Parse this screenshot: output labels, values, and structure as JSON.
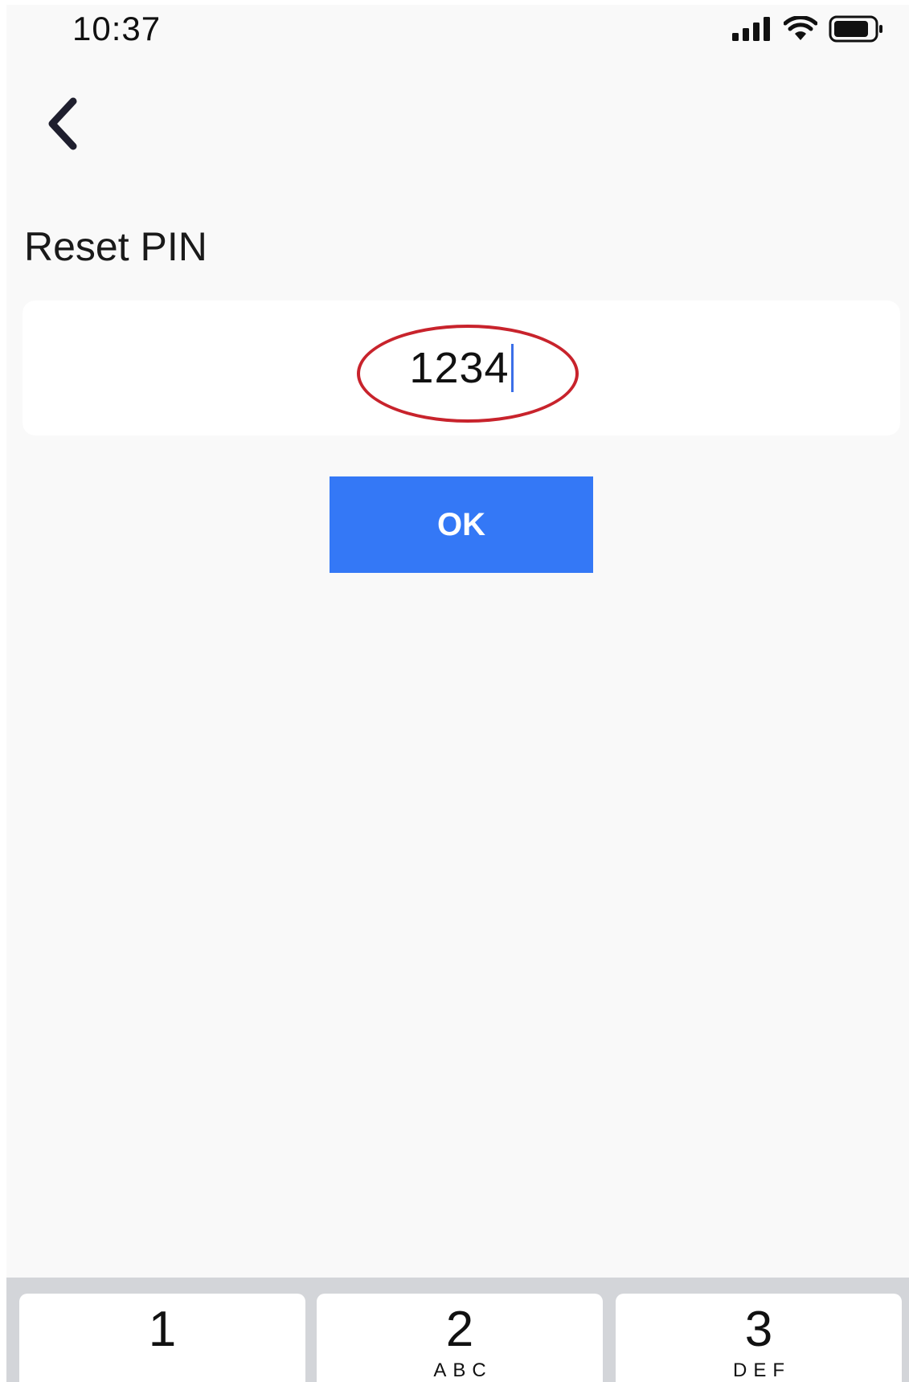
{
  "status_bar": {
    "time": "10:37",
    "signal_icon": "cellular-signal-icon",
    "wifi_icon": "wifi-icon",
    "battery_icon": "battery-icon"
  },
  "header": {
    "back_icon": "chevron-left-icon",
    "title": "Reset PIN"
  },
  "pin_input": {
    "value": "1234"
  },
  "actions": {
    "ok_label": "OK"
  },
  "keypad": {
    "keys": [
      {
        "digit": "1",
        "letters": ""
      },
      {
        "digit": "2",
        "letters": "ABC"
      },
      {
        "digit": "3",
        "letters": "DEF"
      }
    ]
  },
  "colors": {
    "accent": "#3478f6",
    "annotation": "#c8232c",
    "caret": "#3b6fe8",
    "background": "#f9f9f9",
    "keypad_background": "#d3d5d9"
  }
}
